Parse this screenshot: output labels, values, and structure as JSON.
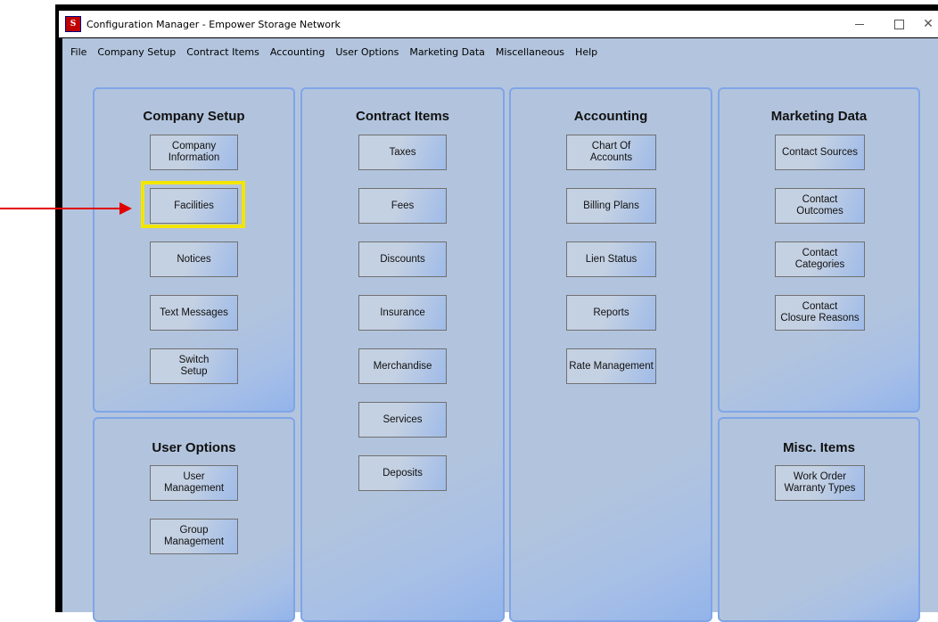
{
  "window": {
    "title": "Configuration Manager - Empower Storage Network",
    "icon": "app-logo-icon",
    "icon_letters": "S"
  },
  "menubar": {
    "items": [
      "File",
      "Company Setup",
      "Contract Items",
      "Accounting",
      "User Options",
      "Marketing Data",
      "Miscellaneous",
      "Help"
    ]
  },
  "panels": {
    "company_setup": {
      "title": "Company Setup",
      "buttons": [
        "Company\nInformation",
        "Facilities",
        "Notices",
        "Text Messages",
        "Switch\nSetup"
      ]
    },
    "user_options": {
      "title": "User Options",
      "buttons": [
        "User\nManagement",
        "Group\nManagement"
      ]
    },
    "contract_items": {
      "title": "Contract Items",
      "buttons": [
        "Taxes",
        "Fees",
        "Discounts",
        "Insurance",
        "Merchandise",
        "Services",
        "Deposits"
      ]
    },
    "accounting": {
      "title": "Accounting",
      "buttons": [
        "Chart Of\nAccounts",
        "Billing Plans",
        "Lien Status",
        "Reports",
        "Rate Management"
      ]
    },
    "marketing_data": {
      "title": "Marketing Data",
      "buttons": [
        "Contact Sources",
        "Contact\nOutcomes",
        "Contact\nCategories",
        "Contact\nClosure Reasons"
      ]
    },
    "misc_items": {
      "title": "Misc. Items",
      "buttons": [
        "Work Order\nWarranty Types"
      ]
    }
  },
  "annotation": {
    "highlighted": "Facilities",
    "highlight_color": "#f2e600",
    "arrow_color": "#e00000"
  },
  "colors": {
    "client_bg": "#b3c5de",
    "panel_border": "#7fa5e8"
  }
}
